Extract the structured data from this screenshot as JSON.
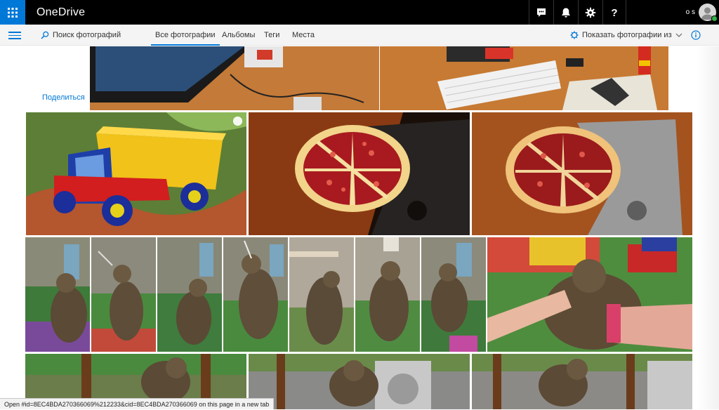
{
  "suitebar": {
    "brand": "OneDrive",
    "user_initials": "o s",
    "buttons": [
      {
        "name": "chat-icon"
      },
      {
        "name": "bell-icon"
      },
      {
        "name": "gear-icon"
      },
      {
        "name": "help-icon",
        "label": "?"
      }
    ],
    "accent": "#0078d7"
  },
  "navbar": {
    "search_placeholder": "Поиск фотографий",
    "tabs": [
      {
        "label": "Все фотографии",
        "active": true
      },
      {
        "label": "Альбомы",
        "active": false
      },
      {
        "label": "Теги",
        "active": false
      },
      {
        "label": "Места",
        "active": false
      }
    ],
    "show_photos_from": "Показать фотографии из"
  },
  "content": {
    "share_label": "Поделиться",
    "photos": [
      {
        "subject": "monitor-desk"
      },
      {
        "subject": "keyboard-desk"
      },
      {
        "subject": "toy-truck"
      },
      {
        "subject": "pomegranate"
      },
      {
        "subject": "pomegranate"
      },
      {
        "subject": "cat"
      },
      {
        "subject": "cat"
      },
      {
        "subject": "cat"
      },
      {
        "subject": "cat"
      },
      {
        "subject": "cat"
      },
      {
        "subject": "cat"
      },
      {
        "subject": "cat"
      },
      {
        "subject": "cat-hand"
      },
      {
        "subject": "cat-chair"
      },
      {
        "subject": "cat-chair"
      },
      {
        "subject": "cat-chair"
      }
    ]
  },
  "statusbar": {
    "text": "Open #id=8EC4BDA270366069%212233&cid=8EC4BDA270366069 on this page in a new tab"
  }
}
